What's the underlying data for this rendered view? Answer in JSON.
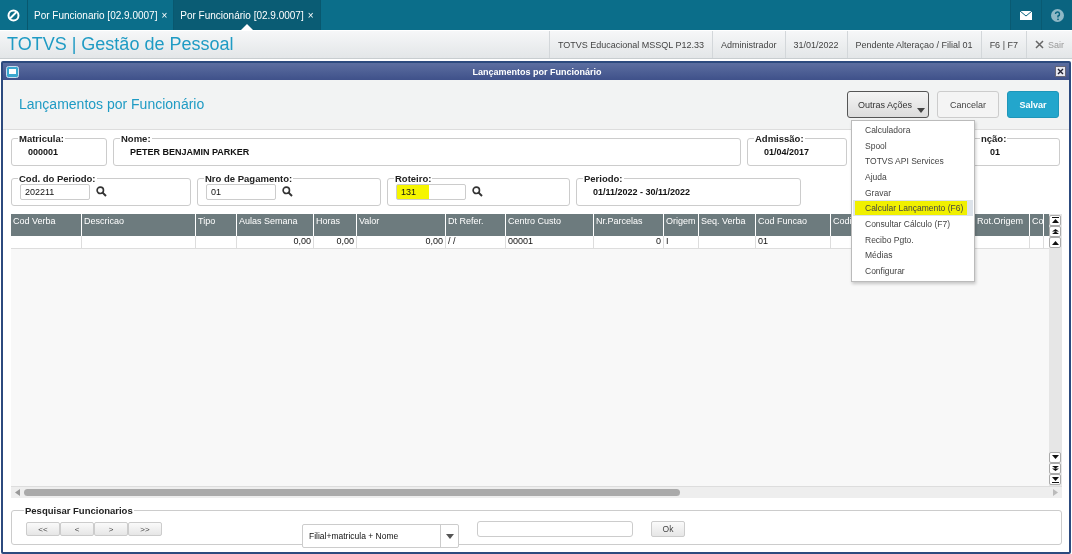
{
  "top_bar": {
    "tabs": [
      {
        "label": "Por Funcionario [02.9.0007]",
        "close": "×",
        "selected": false
      },
      {
        "label": "Por Funcionário [02.9.0007]",
        "close": "×",
        "selected": true
      }
    ]
  },
  "header": {
    "title": "TOTVS | Gestão de Pessoal",
    "info": [
      "TOTVS Educacional MSSQL P12.33",
      "Administrador",
      "31/01/2022",
      "Pendente Alteraçao / Filial 01",
      "F6 | F7"
    ],
    "exit": "Sair"
  },
  "dialog": {
    "title": "Lançamentos por Funcionário",
    "heading": "Lançamentos por Funcionário",
    "actions": [
      {
        "label": "Outras Ações",
        "kind": "menu"
      },
      {
        "label": "Cancelar",
        "kind": "secondary"
      },
      {
        "label": "Salvar",
        "kind": "primary"
      }
    ],
    "field_rows": [
      [
        {
          "label": "Matricula:",
          "value": "000001",
          "kind": "display"
        },
        {
          "label": "Nome:",
          "value": "PETER BENJAMIN PARKER",
          "kind": "display"
        },
        {
          "label": "Admissão:",
          "value": "01/04/2017",
          "kind": "display"
        },
        {
          "label": "nção:",
          "value": "01",
          "kind": "display"
        }
      ],
      [
        {
          "label": "Cod. do Periodo:",
          "value": "202211",
          "kind": "lookup",
          "highlighted": false
        },
        {
          "label": "Nro de Pagamento:",
          "value": "01",
          "kind": "lookup",
          "highlighted": false
        },
        {
          "label": "Roteiro:",
          "value": "131",
          "kind": "lookup",
          "highlighted": true
        },
        {
          "label": "Periodo:",
          "value": "01/11/2022 - 30/11/2022",
          "kind": "display"
        }
      ]
    ],
    "table": {
      "columns": [
        "Cod Verba",
        "Descricao",
        "Tipo",
        "Aulas Semana",
        "Horas",
        "Valor",
        "Dt Refer.",
        "Centro Custo",
        "Nr.Parcelas",
        "Origem",
        "Seq. Verba",
        "Cod Funcao",
        "Codi",
        "Rot.Origem",
        "Co"
      ],
      "rows": [
        {
          "cells": [
            null,
            null,
            null,
            "0,00",
            "0,00",
            "0,00",
            "/ /",
            "00001",
            "0",
            "I",
            null,
            "01",
            null,
            null,
            null
          ]
        }
      ]
    },
    "search": {
      "title": "Pesquisar Funcionarios",
      "nav": [
        "<<",
        "<",
        ">",
        ">>"
      ],
      "order": "Filial+matricula + Nome",
      "button": "Ok"
    },
    "menu": {
      "items": [
        {
          "label": "Calculadora",
          "selected": false,
          "highlighted": false
        },
        {
          "label": "Spool",
          "selected": false,
          "highlighted": false
        },
        {
          "label": "TOTVS API Services",
          "selected": false,
          "highlighted": false
        },
        {
          "label": "Ajuda",
          "selected": false,
          "highlighted": false
        },
        {
          "label": "Gravar",
          "selected": false,
          "highlighted": false
        },
        {
          "label": "Calcular Lançamento (F6)",
          "selected": true,
          "highlighted": true
        },
        {
          "label": "Consultar Cálculo (F7)",
          "selected": false,
          "highlighted": false
        },
        {
          "label": "Recibo Pgto.",
          "selected": false,
          "highlighted": false
        },
        {
          "label": "Médias",
          "selected": false,
          "highlighted": false
        },
        {
          "label": "Configurar",
          "selected": false,
          "highlighted": false
        }
      ]
    }
  }
}
